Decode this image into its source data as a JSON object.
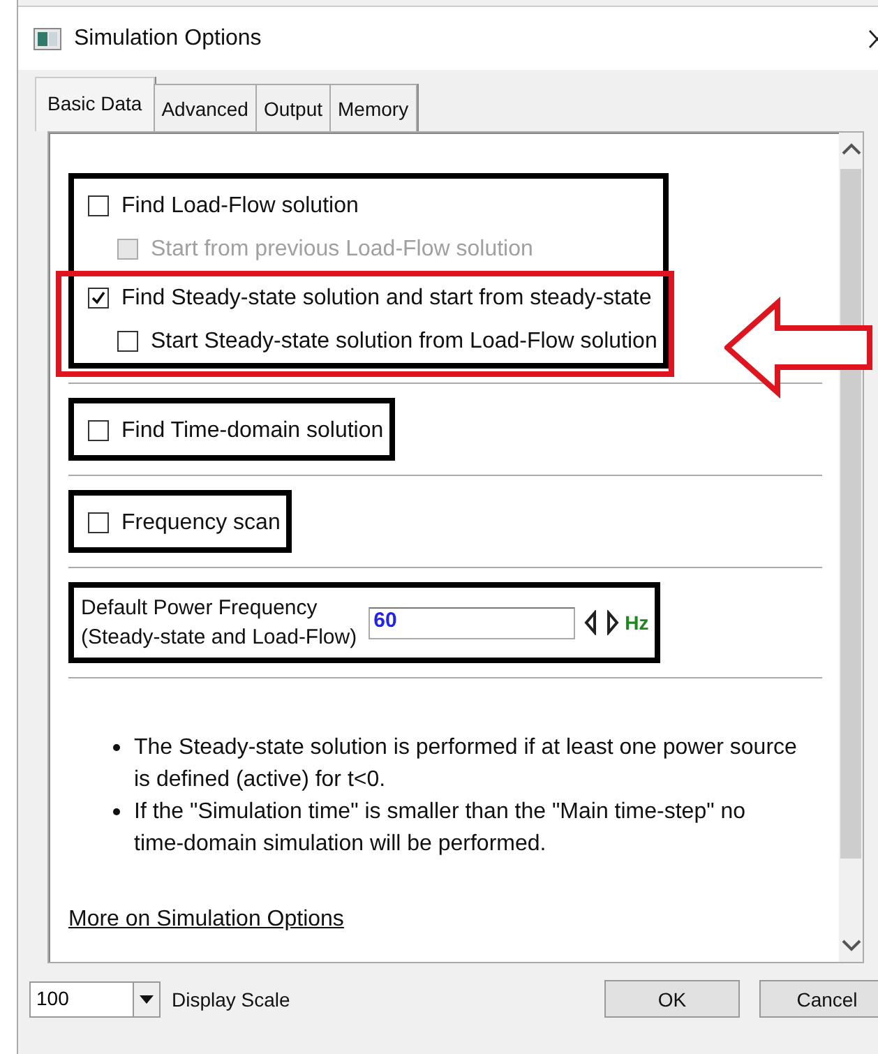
{
  "window": {
    "title": "Simulation Options"
  },
  "tabs": [
    {
      "label": "Basic Data",
      "selected": true
    },
    {
      "label": "Advanced",
      "selected": false
    },
    {
      "label": "Output",
      "selected": false
    },
    {
      "label": "Memory",
      "selected": false
    }
  ],
  "sections": [
    {
      "kind": "checks",
      "items": [
        {
          "label": "Find Load-Flow solution",
          "checked": false,
          "disabled": false,
          "highlighted": false,
          "children": [
            {
              "label": "Start from previous Load-Flow solution",
              "checked": false,
              "disabled": true
            }
          ]
        },
        {
          "label": "Find Steady-state solution and start from steady-state",
          "checked": true,
          "disabled": false,
          "highlighted": true,
          "children": [
            {
              "label": "Start Steady-state solution from Load-Flow solution",
              "checked": false,
              "disabled": false
            }
          ]
        }
      ]
    },
    {
      "kind": "checks",
      "items": [
        {
          "label": "Find Time-domain solution",
          "checked": false,
          "disabled": false,
          "highlighted": false
        }
      ]
    },
    {
      "kind": "checks",
      "items": [
        {
          "label": "Frequency scan",
          "checked": false,
          "disabled": false,
          "highlighted": false
        }
      ]
    },
    {
      "kind": "number",
      "label_lines": [
        "Default Power Frequency",
        "(Steady-state and Load-Flow)"
      ],
      "value": "60",
      "unit": "Hz"
    }
  ],
  "notes": [
    "The Steady-state solution is performed if at least one power source is defined (active) for t<0.",
    "If the \"Simulation time\" is smaller than the \"Main time-step\" no time-domain simulation will be performed."
  ],
  "link": "More on Simulation Options",
  "footer": {
    "scale": "100",
    "scale_label": "Display Scale",
    "buttons": [
      "OK",
      "Cancel"
    ]
  }
}
